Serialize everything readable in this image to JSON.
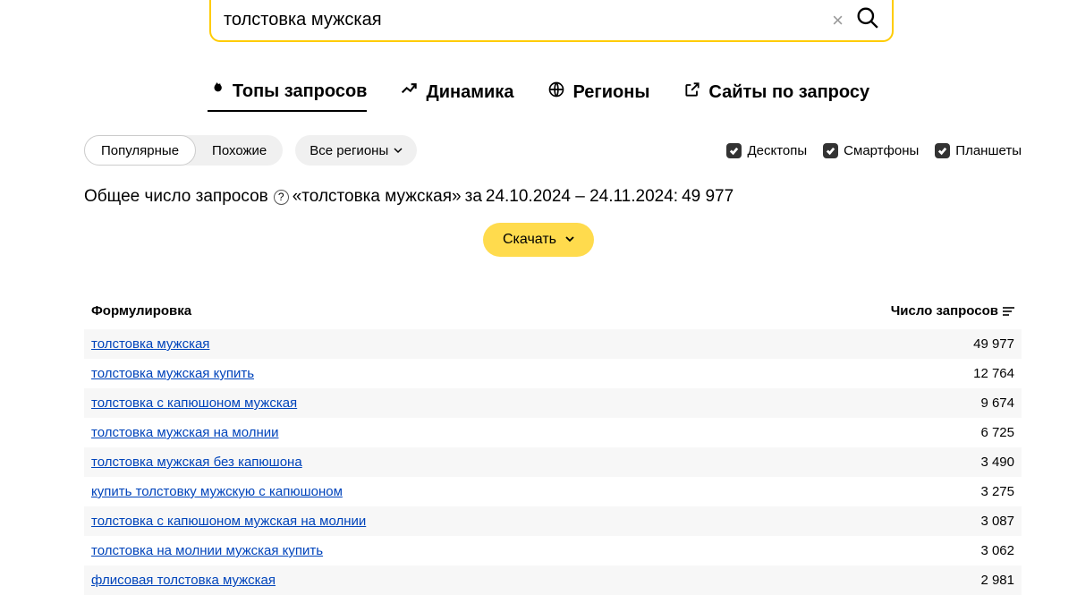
{
  "search": {
    "value": "толстовка мужская"
  },
  "tabs": {
    "tops": "Топы запросов",
    "dynamics": "Динамика",
    "regions": "Регионы",
    "sites": "Сайты по запросу"
  },
  "segments": {
    "popular": "Популярные",
    "similar": "Похожие"
  },
  "region_selector": "Все регионы",
  "devices": {
    "desktop": "Десктопы",
    "smartphones": "Смартфоны",
    "tablets": "Планшеты"
  },
  "summary": {
    "prefix": "Общее число запросов",
    "query_quoted": "«толстовка мужская»",
    "za": "за",
    "date_range": "24.10.2024 – 24.11.2024:",
    "total": "49 977"
  },
  "download_label": "Скачать",
  "columns": {
    "phrase": "Формулировка",
    "count": "Число запросов"
  },
  "rows": [
    {
      "phrase": "толстовка мужская",
      "count": "49 977"
    },
    {
      "phrase": "толстовка мужская купить",
      "count": "12 764"
    },
    {
      "phrase": "толстовка с капюшоном мужская",
      "count": "9 674"
    },
    {
      "phrase": "толстовка мужская на молнии",
      "count": "6 725"
    },
    {
      "phrase": "толстовка мужская без капюшона",
      "count": "3 490"
    },
    {
      "phrase": "купить толстовку мужскую с капюшоном",
      "count": "3 275"
    },
    {
      "phrase": "толстовка с капюшоном мужская на молнии",
      "count": "3 087"
    },
    {
      "phrase": "толстовка на молнии мужская купить",
      "count": "3 062"
    },
    {
      "phrase": "флисовая толстовка мужская",
      "count": "2 981"
    }
  ]
}
